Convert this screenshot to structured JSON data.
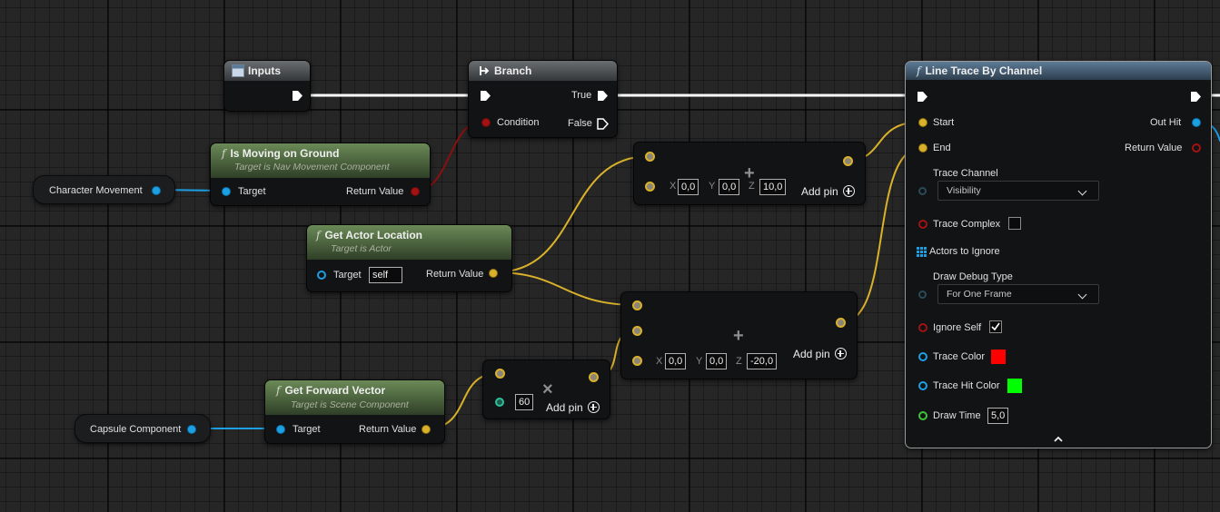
{
  "nodes": {
    "inputs": {
      "title": "Inputs"
    },
    "branch": {
      "title": "Branch",
      "true_label": "True",
      "false_label": "False",
      "condition_label": "Condition"
    },
    "is_moving": {
      "title": "Is Moving on Ground",
      "subtitle": "Target is Nav Movement Component",
      "target_label": "Target",
      "return_label": "Return Value"
    },
    "character_movement": {
      "label": "Character Movement"
    },
    "get_actor_location": {
      "title": "Get Actor Location",
      "subtitle": "Target is Actor",
      "target_label": "Target",
      "target_value": "self",
      "return_label": "Return Value"
    },
    "add_top": {
      "x_label": "X",
      "x": "0,0",
      "y_label": "Y",
      "y": "0,0",
      "z_label": "Z",
      "z": "10,0",
      "add_pin": "Add pin",
      "op": "+"
    },
    "add_bottom": {
      "x_label": "X",
      "x": "0,0",
      "y_label": "Y",
      "y": "0,0",
      "z_label": "Z",
      "z": "-20,0",
      "add_pin": "Add pin",
      "op": "+"
    },
    "multiply": {
      "value": "60",
      "add_pin": "Add pin",
      "op": "×"
    },
    "get_forward_vector": {
      "title": "Get Forward Vector",
      "subtitle": "Target is Scene Component",
      "target_label": "Target",
      "return_label": "Return Value"
    },
    "capsule_component": {
      "label": "Capsule Component"
    },
    "line_trace": {
      "title": "Line Trace By Channel",
      "start_label": "Start",
      "end_label": "End",
      "out_hit_label": "Out Hit",
      "return_label": "Return Value",
      "trace_channel_label": "Trace Channel",
      "trace_channel_value": "Visibility",
      "trace_complex_label": "Trace Complex",
      "actors_to_ignore_label": "Actors to Ignore",
      "draw_debug_type_label": "Draw Debug Type",
      "draw_debug_type_value": "For One Frame",
      "ignore_self_label": "Ignore Self",
      "trace_color_label": "Trace Color",
      "trace_hit_color_label": "Trace Hit Color",
      "draw_time_label": "Draw Time",
      "draw_time_value": "5,0",
      "trace_color": "#ff0000",
      "trace_hit_color": "#00ff00"
    }
  },
  "colors": {
    "exec_wire": "#ffffff",
    "vector_wire": "#d9b12a",
    "object_wire": "#1c9fe3",
    "bool_wire": "#8a1010"
  }
}
